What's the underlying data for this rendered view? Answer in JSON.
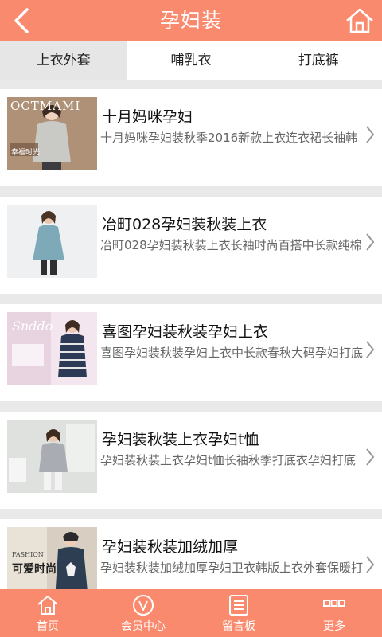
{
  "header": {
    "title": "孕妇装",
    "back_icon": "back-arrow-icon",
    "home_icon": "home-icon"
  },
  "tabs": [
    {
      "label": "上衣外套",
      "active": true
    },
    {
      "label": "哺乳衣",
      "active": false
    },
    {
      "label": "打底裤",
      "active": false
    }
  ],
  "items": [
    {
      "title": "十月妈咪孕妇",
      "desc": "十月妈咪孕妇装秋季2016新款上衣连衣裙长袖韩",
      "thumb_text": "OCTMAMI",
      "thumb_caption": "幸福时光"
    },
    {
      "title": "冶町028孕妇装秋装上衣",
      "desc": "冶町028孕妇装秋装上衣长袖时尚百搭中长款纯棉"
    },
    {
      "title": "喜图孕妇装秋装孕妇上衣",
      "desc": "喜图孕妇装秋装孕妇上衣中长款春秋大码孕妇打底",
      "thumb_text": "Snddo"
    },
    {
      "title": "孕妇装秋装上衣孕妇t恤",
      "desc": "孕妇装秋装上衣孕妇t恤长袖秋季打底衣孕妇打底"
    },
    {
      "title": "孕妇装秋装加绒加厚",
      "desc": "孕妇装秋装加绒加厚孕妇卫衣韩版上衣外套保暖打",
      "thumb_text": "FASHION",
      "thumb_caption": "可爱时尚"
    }
  ],
  "bottom_nav": [
    {
      "label": "首页",
      "icon": "home-icon"
    },
    {
      "label": "会员中心",
      "icon": "member-v-icon"
    },
    {
      "label": "留言板",
      "icon": "message-board-icon"
    },
    {
      "label": "更多",
      "icon": "more-grid-icon"
    }
  ],
  "colors": {
    "accent": "#f98a6e",
    "background": "#e9e9e9"
  }
}
